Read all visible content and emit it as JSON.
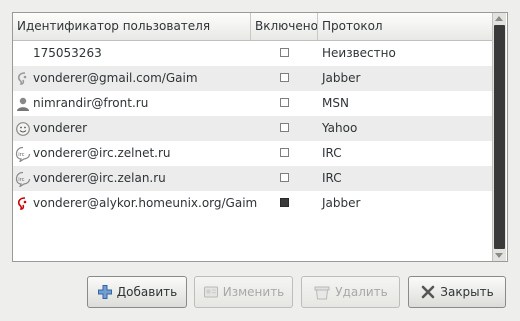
{
  "columns": {
    "user": "Идентификатор пользователя",
    "enabled": "Включено",
    "protocol": "Протокол"
  },
  "accounts": [
    {
      "user": "175053263",
      "protocol": "Неизвестно",
      "enabled": false,
      "icon": "none"
    },
    {
      "user": "vonderer@gmail.com/Gaim",
      "protocol": "Jabber",
      "enabled": false,
      "icon": "jabber-icon"
    },
    {
      "user": "nimrandir@front.ru",
      "protocol": "MSN",
      "enabled": false,
      "icon": "msn-icon"
    },
    {
      "user": "vonderer",
      "protocol": "Yahoo",
      "enabled": false,
      "icon": "yahoo-icon"
    },
    {
      "user": "vonderer@irc.zelnet.ru",
      "protocol": "IRC",
      "enabled": false,
      "icon": "irc-icon"
    },
    {
      "user": "vonderer@irc.zelan.ru",
      "protocol": "IRC",
      "enabled": false,
      "icon": "irc-icon"
    },
    {
      "user": "vonderer@alykor.homeunix.org/Gaim",
      "protocol": "Jabber",
      "enabled": true,
      "icon": "jabber-active-icon"
    }
  ],
  "buttons": {
    "add": "Добавить",
    "modify": "Изменить",
    "delete": "Удалить",
    "close": "Закрыть"
  },
  "colors": {
    "window_bg": "#eeeeec",
    "row_alt": "#ececec",
    "scroll_thumb": "#3a3a3a",
    "jabber_active": "#cc0000",
    "add_icon": "#3465a4"
  }
}
